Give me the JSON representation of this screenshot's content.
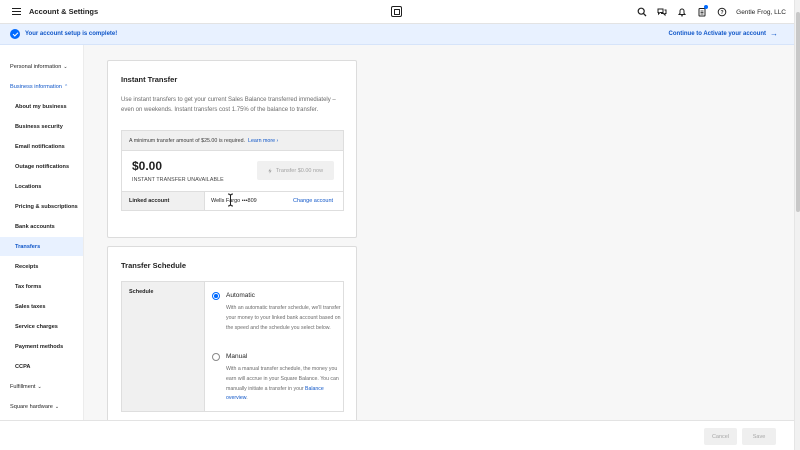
{
  "header": {
    "title": "Account & Settings",
    "business_name": "Gentle Frog, LLC",
    "icons": [
      "menu-icon",
      "square-logo-icon",
      "search-icon",
      "messages-icon",
      "bell-icon",
      "clipboard-icon",
      "help-icon"
    ]
  },
  "banner": {
    "message": "Your account setup is complete!",
    "action": "Continue to Activate your account",
    "arrow": "→"
  },
  "sidebar": {
    "items": [
      {
        "label": "Personal information",
        "chev": "⌄"
      },
      {
        "label": "Business information",
        "chev": "⌃"
      },
      {
        "label": "About my business"
      },
      {
        "label": "Business security"
      },
      {
        "label": "Email notifications"
      },
      {
        "label": "Outage notifications"
      },
      {
        "label": "Locations"
      },
      {
        "label": "Pricing & subscriptions"
      },
      {
        "label": "Bank accounts"
      },
      {
        "label": "Transfers"
      },
      {
        "label": "Receipts"
      },
      {
        "label": "Tax forms"
      },
      {
        "label": "Sales taxes"
      },
      {
        "label": "Service charges"
      },
      {
        "label": "Payment methods"
      },
      {
        "label": "CCPA"
      },
      {
        "label": "Fulfillment",
        "chev": "⌄"
      },
      {
        "label": "Square hardware",
        "chev": "⌄"
      }
    ],
    "active": "Transfers"
  },
  "instant_transfer": {
    "title": "Instant Transfer",
    "description": "Use instant transfers to get your current Sales Balance transferred immediately – even on weekends. Instant transfers cost 1.75% of the balance to transfer.",
    "minimum_text": "A minimum transfer amount of $25.00 is required.",
    "learn_more": "Learn more ›",
    "amount": "$0.00",
    "status": "INSTANT TRANSFER UNAVAILABLE",
    "transfer_button": "Transfer $0.00 now",
    "linked_label": "Linked account",
    "linked_value": "Wells Fargo •••809",
    "change_link": "Change account"
  },
  "transfer_schedule": {
    "title": "Transfer Schedule",
    "label": "Schedule",
    "options": [
      {
        "title": "Automatic",
        "description": "With an automatic transfer schedule, we'll transfer your money to your linked bank account based on the speed and the schedule you select below.",
        "checked": true
      },
      {
        "title": "Manual",
        "description_prefix": "With a manual transfer schedule, the money you earn will accrue in your Square Balance. You can manually initiate a transfer in your ",
        "link": "Balance overview",
        "suffix": ".",
        "checked": false
      }
    ]
  },
  "footer": {
    "cancel": "Cancel",
    "save": "Save"
  },
  "colors": {
    "accent": "#006aff",
    "link": "#0f56c8",
    "banner_bg": "#e8f1ff"
  }
}
